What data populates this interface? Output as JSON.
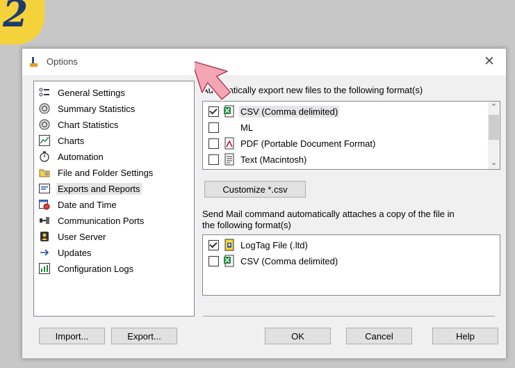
{
  "badge": {
    "number": "2"
  },
  "window": {
    "title": "Options",
    "close_glyph": "✕"
  },
  "nav": {
    "items": [
      {
        "label": "General Settings",
        "icon": "settings-list-icon"
      },
      {
        "label": "Summary Statistics",
        "icon": "statistics-icon"
      },
      {
        "label": "Chart Statistics",
        "icon": "statistics-icon"
      },
      {
        "label": "Charts",
        "icon": "chart-icon"
      },
      {
        "label": "Automation",
        "icon": "stopwatch-icon"
      },
      {
        "label": "File and Folder Settings",
        "icon": "folder-icon"
      },
      {
        "label": "Exports and Reports",
        "icon": "export-report-icon",
        "selected": true
      },
      {
        "label": "Date and Time",
        "icon": "calendar-clock-icon"
      },
      {
        "label": "Communication Ports",
        "icon": "port-icon"
      },
      {
        "label": "User Server",
        "icon": "user-server-icon"
      },
      {
        "label": "Updates",
        "icon": "arrow-right-icon"
      },
      {
        "label": "Configuration Logs",
        "icon": "log-icon"
      }
    ]
  },
  "export": {
    "label": "Automatically export new files to the following format(s)",
    "formats": [
      {
        "label": "CSV (Comma delimited)",
        "checked": true
      },
      {
        "label": "XML",
        "checked": false
      },
      {
        "label": "PDF (Portable Document Format)",
        "checked": false
      },
      {
        "label": "Text (Macintosh)",
        "checked": false
      }
    ],
    "visible_formats": [
      {
        "label": "CSV (Comma delimited)"
      },
      {
        "label": "ML"
      },
      {
        "label": "PDF (Portable Document Format)"
      },
      {
        "label": "Text (Macintosh)"
      }
    ],
    "customize_button": "Customize *.csv"
  },
  "mail": {
    "label_line1": "Send Mail command automatically attaches a copy of the file in",
    "label_line2": "the following format(s)",
    "formats": [
      {
        "label": "LogTag File (.ltd)",
        "checked": true
      },
      {
        "label": "CSV (Comma delimited)",
        "checked": false
      }
    ]
  },
  "buttons": {
    "import": "Import...",
    "export": "Export...",
    "ok": "OK",
    "cancel": "Cancel",
    "help": "Help"
  },
  "colors": {
    "badge": "#f5d23b",
    "cursor_fill": "#f3a6b4"
  }
}
